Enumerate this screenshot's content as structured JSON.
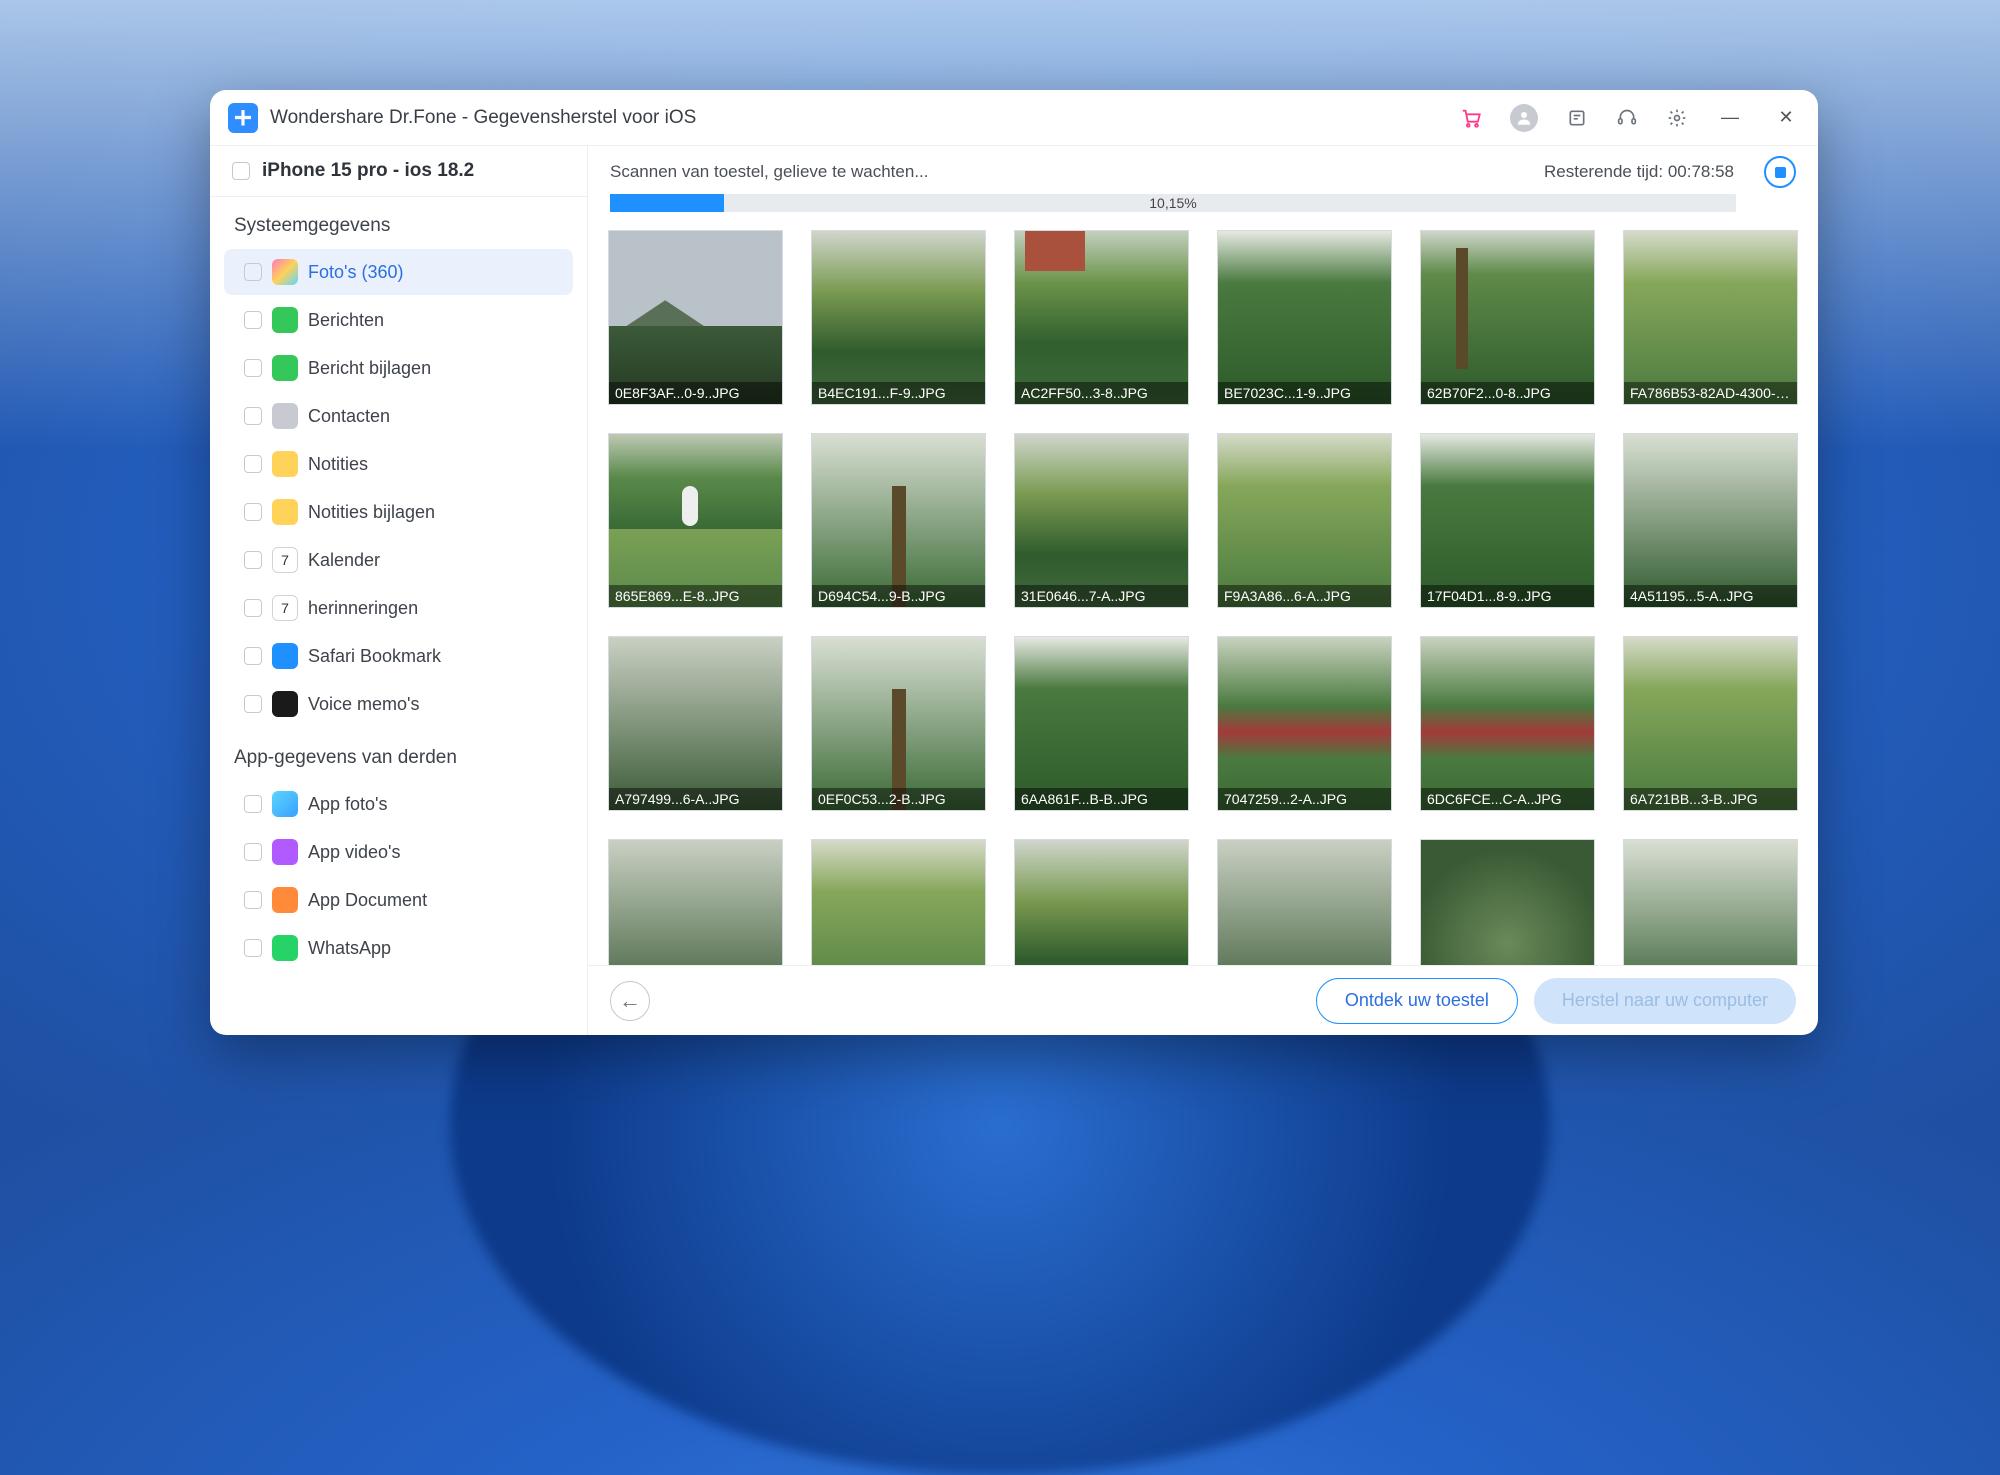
{
  "app": {
    "title": "Wondershare Dr.Fone - Gegevensherstel voor iOS"
  },
  "device": {
    "name": "iPhone 15 pro - ios 18.2"
  },
  "scan": {
    "status": "Scannen van toestel, gelieve te wachten...",
    "remaining_label": "Resterende tijd:",
    "remaining_time": "00:78:58",
    "percent_label": "10,15%",
    "percent_width": "10.15%"
  },
  "sidebar": {
    "section_system": "Systeemgegevens",
    "section_third": "App-gegevens van derden",
    "system": [
      {
        "label": "Foto's (360)",
        "icon_bg": "linear-gradient(135deg,#ff7ab5,#ffd25a,#5ad5ff)",
        "active": true
      },
      {
        "label": "Berichten",
        "icon_bg": "#34c759"
      },
      {
        "label": "Bericht bijlagen",
        "icon_bg": "#34c759"
      },
      {
        "label": "Contacten",
        "icon_bg": "#c7cbd1"
      },
      {
        "label": "Notities",
        "icon_bg": "#ffd25a"
      },
      {
        "label": "Notities bijlagen",
        "icon_bg": "#ffd25a"
      },
      {
        "label": "Kalender",
        "icon_bg": "#fff",
        "icon_text": "7"
      },
      {
        "label": "herinneringen",
        "icon_bg": "#fff",
        "icon_text": "7"
      },
      {
        "label": "Safari Bookmark",
        "icon_bg": "#1e90ff"
      },
      {
        "label": "Voice memo's",
        "icon_bg": "#1a1a1a"
      }
    ],
    "third": [
      {
        "label": "App foto's",
        "icon_bg": "linear-gradient(135deg,#5ad5ff,#3aa0ff)"
      },
      {
        "label": "App video's",
        "icon_bg": "#b05aff"
      },
      {
        "label": "App Document",
        "icon_bg": "#ff8a3a"
      },
      {
        "label": "WhatsApp",
        "icon_bg": "#25d366"
      }
    ]
  },
  "thumbs": [
    {
      "label": "0E8F3AF...0-9..JPG",
      "cls": "sc-mountain"
    },
    {
      "label": "B4EC191...F-9..JPG",
      "cls": "sc-garden1"
    },
    {
      "label": "AC2FF50...3-8..JPG",
      "cls": "sc-garden2"
    },
    {
      "label": "BE7023C...1-9..JPG",
      "cls": "sc-pine"
    },
    {
      "label": "62B70F2...0-8..JPG",
      "cls": "sc-palm"
    },
    {
      "label": "FA786B53-82AD-4300-B...",
      "cls": "sc-bush"
    },
    {
      "label": "865E869...E-8..JPG",
      "cls": "sc-lawn"
    },
    {
      "label": "D694C54...9-B..JPG",
      "cls": "sc-tree"
    },
    {
      "label": "31E0646...7-A..JPG",
      "cls": "sc-garden1"
    },
    {
      "label": "F9A3A86...6-A..JPG",
      "cls": "sc-bush"
    },
    {
      "label": "17F04D1...8-9..JPG",
      "cls": "sc-pine"
    },
    {
      "label": "4A51195...5-A..JPG",
      "cls": "sc-tall"
    },
    {
      "label": "A797499...6-A..JPG",
      "cls": "sc-forest"
    },
    {
      "label": "0EF0C53...2-B..JPG",
      "cls": "sc-tree"
    },
    {
      "label": "6AA861F...B-B..JPG",
      "cls": "sc-pine"
    },
    {
      "label": "7047259...2-A..JPG",
      "cls": "sc-flowers"
    },
    {
      "label": "6DC6FCE...C-A..JPG",
      "cls": "sc-flowers"
    },
    {
      "label": "6A721BB...3-B..JPG",
      "cls": "sc-bush"
    },
    {
      "label": "",
      "cls": "sc-forest"
    },
    {
      "label": "",
      "cls": "sc-bush"
    },
    {
      "label": "",
      "cls": "sc-garden1"
    },
    {
      "label": "",
      "cls": "sc-forest"
    },
    {
      "label": "",
      "cls": "sc-agave"
    },
    {
      "label": "",
      "cls": "sc-tall"
    }
  ],
  "footer": {
    "discover": "Ontdek uw toestel",
    "restore": "Herstel naar uw computer"
  }
}
